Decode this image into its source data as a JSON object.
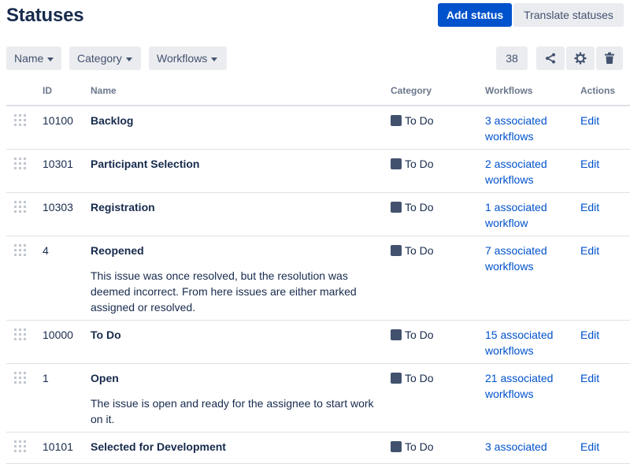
{
  "header": {
    "title": "Statuses",
    "add_button": "Add status",
    "translate_button": "Translate statuses"
  },
  "filters": {
    "name": "Name",
    "category": "Category",
    "workflows": "Workflows"
  },
  "toolbar": {
    "count": "38",
    "icons": [
      "share-icon",
      "gear-icon",
      "trash-icon"
    ]
  },
  "table": {
    "headers": {
      "id": "ID",
      "name": "Name",
      "category": "Category",
      "workflows": "Workflows",
      "actions": "Actions"
    },
    "rows": [
      {
        "id": "10100",
        "name": "Backlog",
        "description": "",
        "category": "To Do",
        "workflows": "3 associated workflows",
        "action": "Edit"
      },
      {
        "id": "10301",
        "name": "Participant Selection",
        "description": "",
        "category": "To Do",
        "workflows": "2 associated workflows",
        "action": "Edit"
      },
      {
        "id": "10303",
        "name": "Registration",
        "description": "",
        "category": "To Do",
        "workflows": "1 associated workflow",
        "action": "Edit"
      },
      {
        "id": "4",
        "name": "Reopened",
        "description": "This issue was once resolved, but the resolution was deemed incorrect. From here issues are either marked assigned or resolved.",
        "category": "To Do",
        "workflows": "7 associated workflows",
        "action": "Edit"
      },
      {
        "id": "10000",
        "name": "To Do",
        "description": "",
        "category": "To Do",
        "workflows": "15 associated workflows",
        "action": "Edit"
      },
      {
        "id": "1",
        "name": "Open",
        "description": "The issue is open and ready for the assignee to start work on it.",
        "category": "To Do",
        "workflows": "21 associated workflows",
        "action": "Edit"
      },
      {
        "id": "10101",
        "name": "Selected for Development",
        "description": "",
        "category": "To Do",
        "workflows": "3 associated",
        "action": "Edit"
      }
    ]
  },
  "colors": {
    "primary": "#0052cc",
    "category_todo": "#42526e",
    "button_bg": "#ebecf0"
  }
}
